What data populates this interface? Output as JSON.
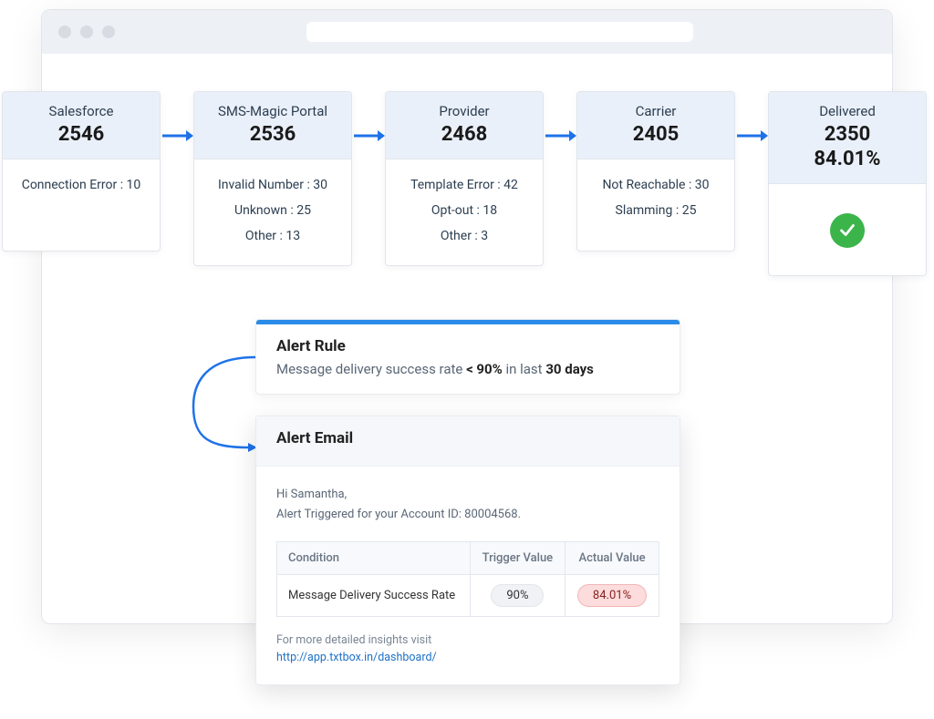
{
  "stages": [
    {
      "title": "Salesforce",
      "count": "2546",
      "errors": [
        "Connection Error : 10"
      ]
    },
    {
      "title": "SMS-Magic Portal",
      "count": "2536",
      "errors": [
        "Invalid Number : 30",
        "Unknown : 25",
        "Other : 13"
      ]
    },
    {
      "title": "Provider",
      "count": "2468",
      "errors": [
        "Template Error : 42",
        "Opt-out : 18",
        "Other : 3"
      ]
    },
    {
      "title": "Carrier",
      "count": "2405",
      "errors": [
        "Not Reachable : 30",
        "Slamming : 25"
      ]
    },
    {
      "title": "Delivered",
      "count": "2350",
      "pct": "84.01%"
    }
  ],
  "alert_rule": {
    "title": "Alert Rule",
    "prefix": "Message delivery success rate ",
    "threshold": "< 90%",
    "mid": " in last ",
    "window": "30 days"
  },
  "alert_email": {
    "title": "Alert Email",
    "greeting": "Hi Samantha,",
    "line2": "Alert Triggered for your Account ID: 80004568.",
    "table": {
      "h1": "Condition",
      "h2": "Trigger Value",
      "h3": "Actual Value",
      "condition": "Message Delivery Success Rate",
      "trigger": "90%",
      "actual": "84.01%"
    },
    "footer_text": "For more detailed insights visit",
    "link": "http://app.txtbox.in/dashboard/"
  }
}
